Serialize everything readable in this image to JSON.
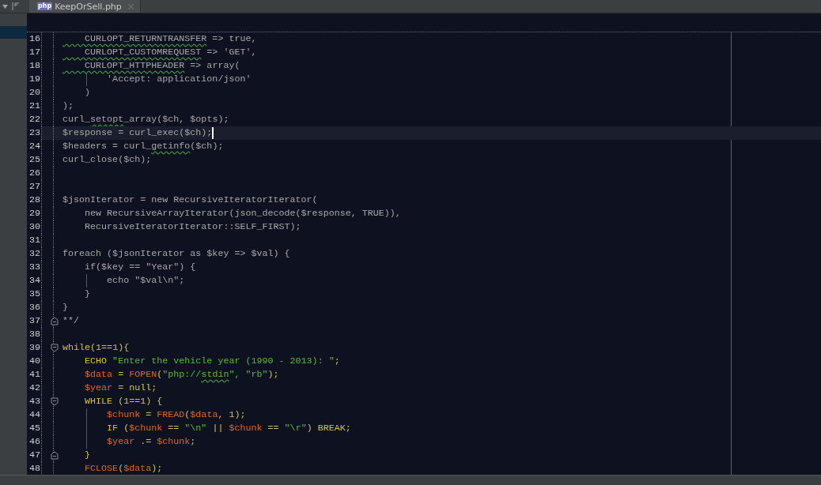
{
  "tab": {
    "label": "KeepOrSell.php",
    "file_type": "php",
    "selected": true
  },
  "editor": {
    "lines": [
      {
        "number": "16",
        "kind": "code",
        "guide": false,
        "current": false,
        "segments": [
          {
            "kind": "comment-typo",
            "text": "    CURLOPT_RETURNTRANSFER"
          },
          {
            "kind": "comment",
            "text": " => true,"
          }
        ]
      },
      {
        "number": "17",
        "kind": "code",
        "guide": false,
        "current": false,
        "segments": [
          {
            "kind": "comment-typo",
            "text": "    CURLOPT_CUSTOMREQUEST"
          },
          {
            "kind": "comment",
            "text": " => 'GET',"
          }
        ]
      },
      {
        "number": "18",
        "kind": "code",
        "guide": false,
        "current": false,
        "segments": [
          {
            "kind": "comment-typo",
            "text": "    CURLOPT_HTTPHEADER"
          },
          {
            "kind": "comment",
            "text": " => array("
          }
        ]
      },
      {
        "number": "19",
        "kind": "code",
        "guide": true,
        "current": false,
        "segments": [
          {
            "kind": "comment",
            "text": "        'Accept: application/json'"
          }
        ]
      },
      {
        "number": "20",
        "kind": "code",
        "guide": false,
        "current": false,
        "segments": [
          {
            "kind": "comment",
            "text": "    )"
          }
        ]
      },
      {
        "number": "21",
        "kind": "code",
        "guide": false,
        "current": false,
        "segments": [
          {
            "kind": "comment",
            "text": ");"
          }
        ]
      },
      {
        "number": "22",
        "kind": "code",
        "guide": false,
        "current": false,
        "segments": [
          {
            "kind": "comment",
            "text": "curl_"
          },
          {
            "kind": "comment-typo",
            "text": "setopt"
          },
          {
            "kind": "comment",
            "text": "_array($ch, $opts);"
          }
        ]
      },
      {
        "number": "23",
        "kind": "code",
        "guide": false,
        "current": true,
        "segments": [
          {
            "kind": "comment",
            "text": "$response = curl_exec($ch);"
          }
        ]
      },
      {
        "number": "24",
        "kind": "code",
        "guide": false,
        "current": false,
        "segments": [
          {
            "kind": "comment",
            "text": "$headers = curl_"
          },
          {
            "kind": "comment-typo",
            "text": "getinfo"
          },
          {
            "kind": "comment",
            "text": "($ch);"
          }
        ]
      },
      {
        "number": "25",
        "kind": "code",
        "guide": false,
        "current": false,
        "segments": [
          {
            "kind": "comment",
            "text": "curl_close($ch);"
          }
        ]
      },
      {
        "number": "26",
        "kind": "code",
        "guide": false,
        "current": false
      },
      {
        "number": "27",
        "kind": "code",
        "guide": false,
        "current": false
      },
      {
        "number": "28",
        "kind": "code",
        "guide": false,
        "current": false,
        "segments": [
          {
            "kind": "comment",
            "text": "$jsonIterator = new RecursiveIteratorIterator("
          }
        ]
      },
      {
        "number": "29",
        "kind": "code",
        "guide": false,
        "current": false,
        "segments": [
          {
            "kind": "comment",
            "text": "    new RecursiveArrayIterator(json_decode($response, TRUE)),"
          }
        ]
      },
      {
        "number": "30",
        "kind": "code",
        "guide": false,
        "current": false,
        "segments": [
          {
            "kind": "comment",
            "text": "    RecursiveIteratorIterator::SELF_FIRST);"
          }
        ]
      },
      {
        "number": "31",
        "kind": "code",
        "guide": false,
        "current": false
      },
      {
        "number": "32",
        "kind": "code",
        "guide": false,
        "current": false,
        "segments": [
          {
            "kind": "comment",
            "text": "foreach ($jsonIterator as $key => $val) {"
          }
        ]
      },
      {
        "number": "33",
        "kind": "code",
        "guide": false,
        "current": false,
        "segments": [
          {
            "kind": "comment",
            "text": "    if($key == \"Year\") {"
          }
        ]
      },
      {
        "number": "34",
        "kind": "code",
        "guide": true,
        "current": false,
        "segments": [
          {
            "kind": "comment",
            "text": "        echo \"$val\\n\";"
          }
        ]
      },
      {
        "number": "35",
        "kind": "code",
        "guide": false,
        "current": false,
        "segments": [
          {
            "kind": "comment",
            "text": "    }"
          }
        ]
      },
      {
        "number": "36",
        "kind": "code",
        "guide": false,
        "current": false,
        "segments": [
          {
            "kind": "comment",
            "text": "}"
          }
        ]
      },
      {
        "number": "37",
        "kind": "fold-end",
        "guide": false,
        "current": false,
        "segments": [
          {
            "kind": "comment",
            "text": "**/"
          }
        ]
      },
      {
        "number": "38",
        "kind": "code",
        "guide": false,
        "current": false
      },
      {
        "number": "39",
        "kind": "fold-start",
        "guide": false,
        "current": false,
        "segments": [
          {
            "kind": "keyword",
            "text": "while"
          },
          {
            "kind": "punct",
            "text": "(1==1){"
          }
        ]
      },
      {
        "number": "40",
        "kind": "code",
        "guide": false,
        "current": false,
        "segments": [
          {
            "kind": "keyword",
            "text": "    ECHO"
          },
          {
            "kind": "string",
            "text": " \"Enter the vehicle year (1990 - 2013): \""
          },
          {
            "kind": "punct",
            "text": ";"
          }
        ]
      },
      {
        "number": "41",
        "kind": "code",
        "guide": false,
        "current": false,
        "segments": [
          {
            "kind": "variable",
            "text": "    $data"
          },
          {
            "kind": "punct",
            "text": " = "
          },
          {
            "kind": "function",
            "text": "FOPEN"
          },
          {
            "kind": "punct",
            "text": "("
          },
          {
            "kind": "string",
            "text": "\"php://"
          },
          {
            "kind": "string-typo",
            "text": "stdin"
          },
          {
            "kind": "string",
            "text": "\", \"rb\""
          },
          {
            "kind": "punct",
            "text": ");"
          }
        ]
      },
      {
        "number": "42",
        "kind": "code",
        "guide": false,
        "current": false,
        "segments": [
          {
            "kind": "variable",
            "text": "    $year"
          },
          {
            "kind": "punct",
            "text": " = null;"
          }
        ]
      },
      {
        "number": "43",
        "kind": "fold-start",
        "guide": false,
        "current": false,
        "segments": [
          {
            "kind": "keyword",
            "text": "    WHILE"
          },
          {
            "kind": "punct",
            "text": " (1==1) {"
          }
        ]
      },
      {
        "number": "44",
        "kind": "code",
        "guide": true,
        "current": false,
        "segments": [
          {
            "kind": "variable",
            "text": "        $chunk"
          },
          {
            "kind": "punct",
            "text": " = "
          },
          {
            "kind": "function",
            "text": "FREAD"
          },
          {
            "kind": "punct",
            "text": "("
          },
          {
            "kind": "variable",
            "text": "$data"
          },
          {
            "kind": "punct",
            "text": ", 1);"
          }
        ]
      },
      {
        "number": "45",
        "kind": "code",
        "guide": true,
        "current": false,
        "segments": [
          {
            "kind": "keyword",
            "text": "        IF"
          },
          {
            "kind": "punct",
            "text": " ("
          },
          {
            "kind": "variable",
            "text": "$chunk"
          },
          {
            "kind": "punct",
            "text": " == "
          },
          {
            "kind": "string",
            "text": "\"\\n\""
          },
          {
            "kind": "punct",
            "text": " || "
          },
          {
            "kind": "variable",
            "text": "$chunk"
          },
          {
            "kind": "punct",
            "text": " == "
          },
          {
            "kind": "string",
            "text": "\"\\r\""
          },
          {
            "kind": "punct",
            "text": ") "
          },
          {
            "kind": "keyword",
            "text": "BREAK"
          },
          {
            "kind": "punct",
            "text": ";"
          }
        ]
      },
      {
        "number": "46",
        "kind": "code",
        "guide": true,
        "current": false,
        "segments": [
          {
            "kind": "variable",
            "text": "        $year"
          },
          {
            "kind": "punct",
            "text": " .= "
          },
          {
            "kind": "variable",
            "text": "$chunk"
          },
          {
            "kind": "punct",
            "text": ";"
          }
        ]
      },
      {
        "number": "47",
        "kind": "fold-end",
        "guide": false,
        "current": false,
        "segments": [
          {
            "kind": "punct",
            "text": "    }"
          }
        ]
      },
      {
        "number": "48",
        "kind": "code",
        "guide": false,
        "current": false,
        "segments": [
          {
            "kind": "function",
            "text": "    FCLOSE"
          },
          {
            "kind": "punct",
            "text": "("
          },
          {
            "kind": "variable",
            "text": "$data"
          },
          {
            "kind": "punct",
            "text": ");"
          }
        ]
      }
    ]
  }
}
